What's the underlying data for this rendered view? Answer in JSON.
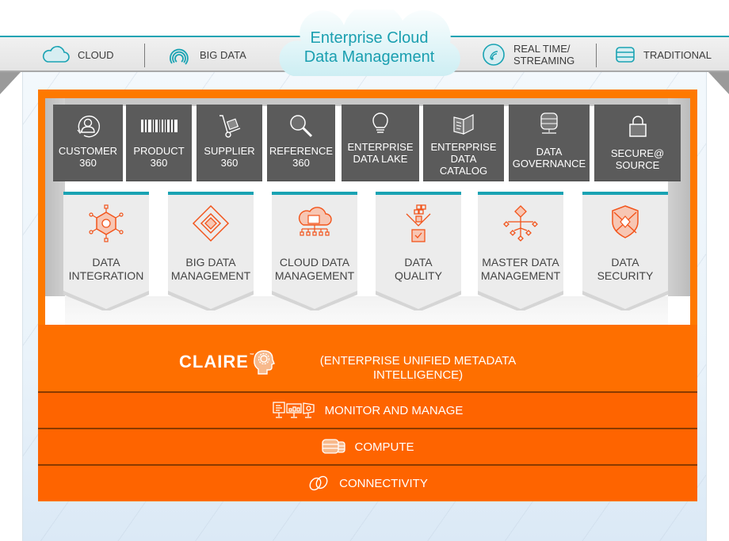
{
  "header": {
    "title_line1": "Enterprise Cloud",
    "title_line2": "Data Management",
    "sources": [
      {
        "icon": "cloud-icon",
        "label": "CLOUD"
      },
      {
        "icon": "radar-arcs-icon",
        "label": "BIG DATA"
      },
      {
        "icon": "streaming-clock-icon",
        "label_line1": "REAL TIME/",
        "label_line2": "STREAMING"
      },
      {
        "icon": "database-stack-icon",
        "label": "TRADITIONAL"
      }
    ]
  },
  "solutions": [
    {
      "icon": "customer-cycle-icon",
      "line1": "CUSTOMER",
      "line2": "360"
    },
    {
      "icon": "barcode-icon",
      "line1": "PRODUCT",
      "line2": "360"
    },
    {
      "icon": "hand-truck-icon",
      "line1": "SUPPLIER",
      "line2": "360"
    },
    {
      "icon": "magnifier-icon",
      "line1": "REFERENCE",
      "line2": "360"
    },
    {
      "icon": "lightbulb-icon",
      "line1": "ENTERPRISE",
      "line2": "DATA  LAKE"
    },
    {
      "icon": "open-book-icon",
      "line1": "ENTERPRISE",
      "line2": "DATA",
      "line3": "CATALOG"
    },
    {
      "icon": "database-network-icon",
      "line1": "DATA",
      "line2": "GOVERNANCE"
    },
    {
      "icon": "padlock-icon",
      "line1": "SECURE@",
      "line2": "SOURCE"
    }
  ],
  "products": [
    {
      "icon": "hexagon-hub-icon",
      "line1": "DATA",
      "line2": "INTEGRATION"
    },
    {
      "icon": "diamond-cycle-icon",
      "line1": "BIG DATA",
      "line2": "MANAGEMENT"
    },
    {
      "icon": "cloud-network-icon",
      "line1": "CLOUD DATA",
      "line2": "MANAGEMENT"
    },
    {
      "icon": "funnel-check-icon",
      "line1": "DATA",
      "line2": "QUALITY"
    },
    {
      "icon": "diamond-tree-icon",
      "line1": "MASTER DATA",
      "line2": "MANAGEMENT"
    },
    {
      "icon": "shield-icon",
      "line1": "DATA",
      "line2": "SECURITY"
    }
  ],
  "claire": {
    "logo": "CLAIRE",
    "trademark": "™",
    "desc_line1": "(ENTERPRISE UNIFIED METADATA",
    "desc_line2": "INTELLIGENCE)"
  },
  "layers": [
    {
      "icon": "monitors-icon",
      "label": "MONITOR AND MANAGE"
    },
    {
      "icon": "database-cylinders-icon",
      "label": "COMPUTE"
    },
    {
      "icon": "chain-links-icon",
      "label": "CONNECTIVITY"
    }
  ],
  "colors": {
    "orange": "#fe7900",
    "orange_dark": "#fe6400",
    "teal": "#1aa3b3",
    "tile_gray": "#5b5b5b",
    "icon_orange": "#f2541b"
  }
}
